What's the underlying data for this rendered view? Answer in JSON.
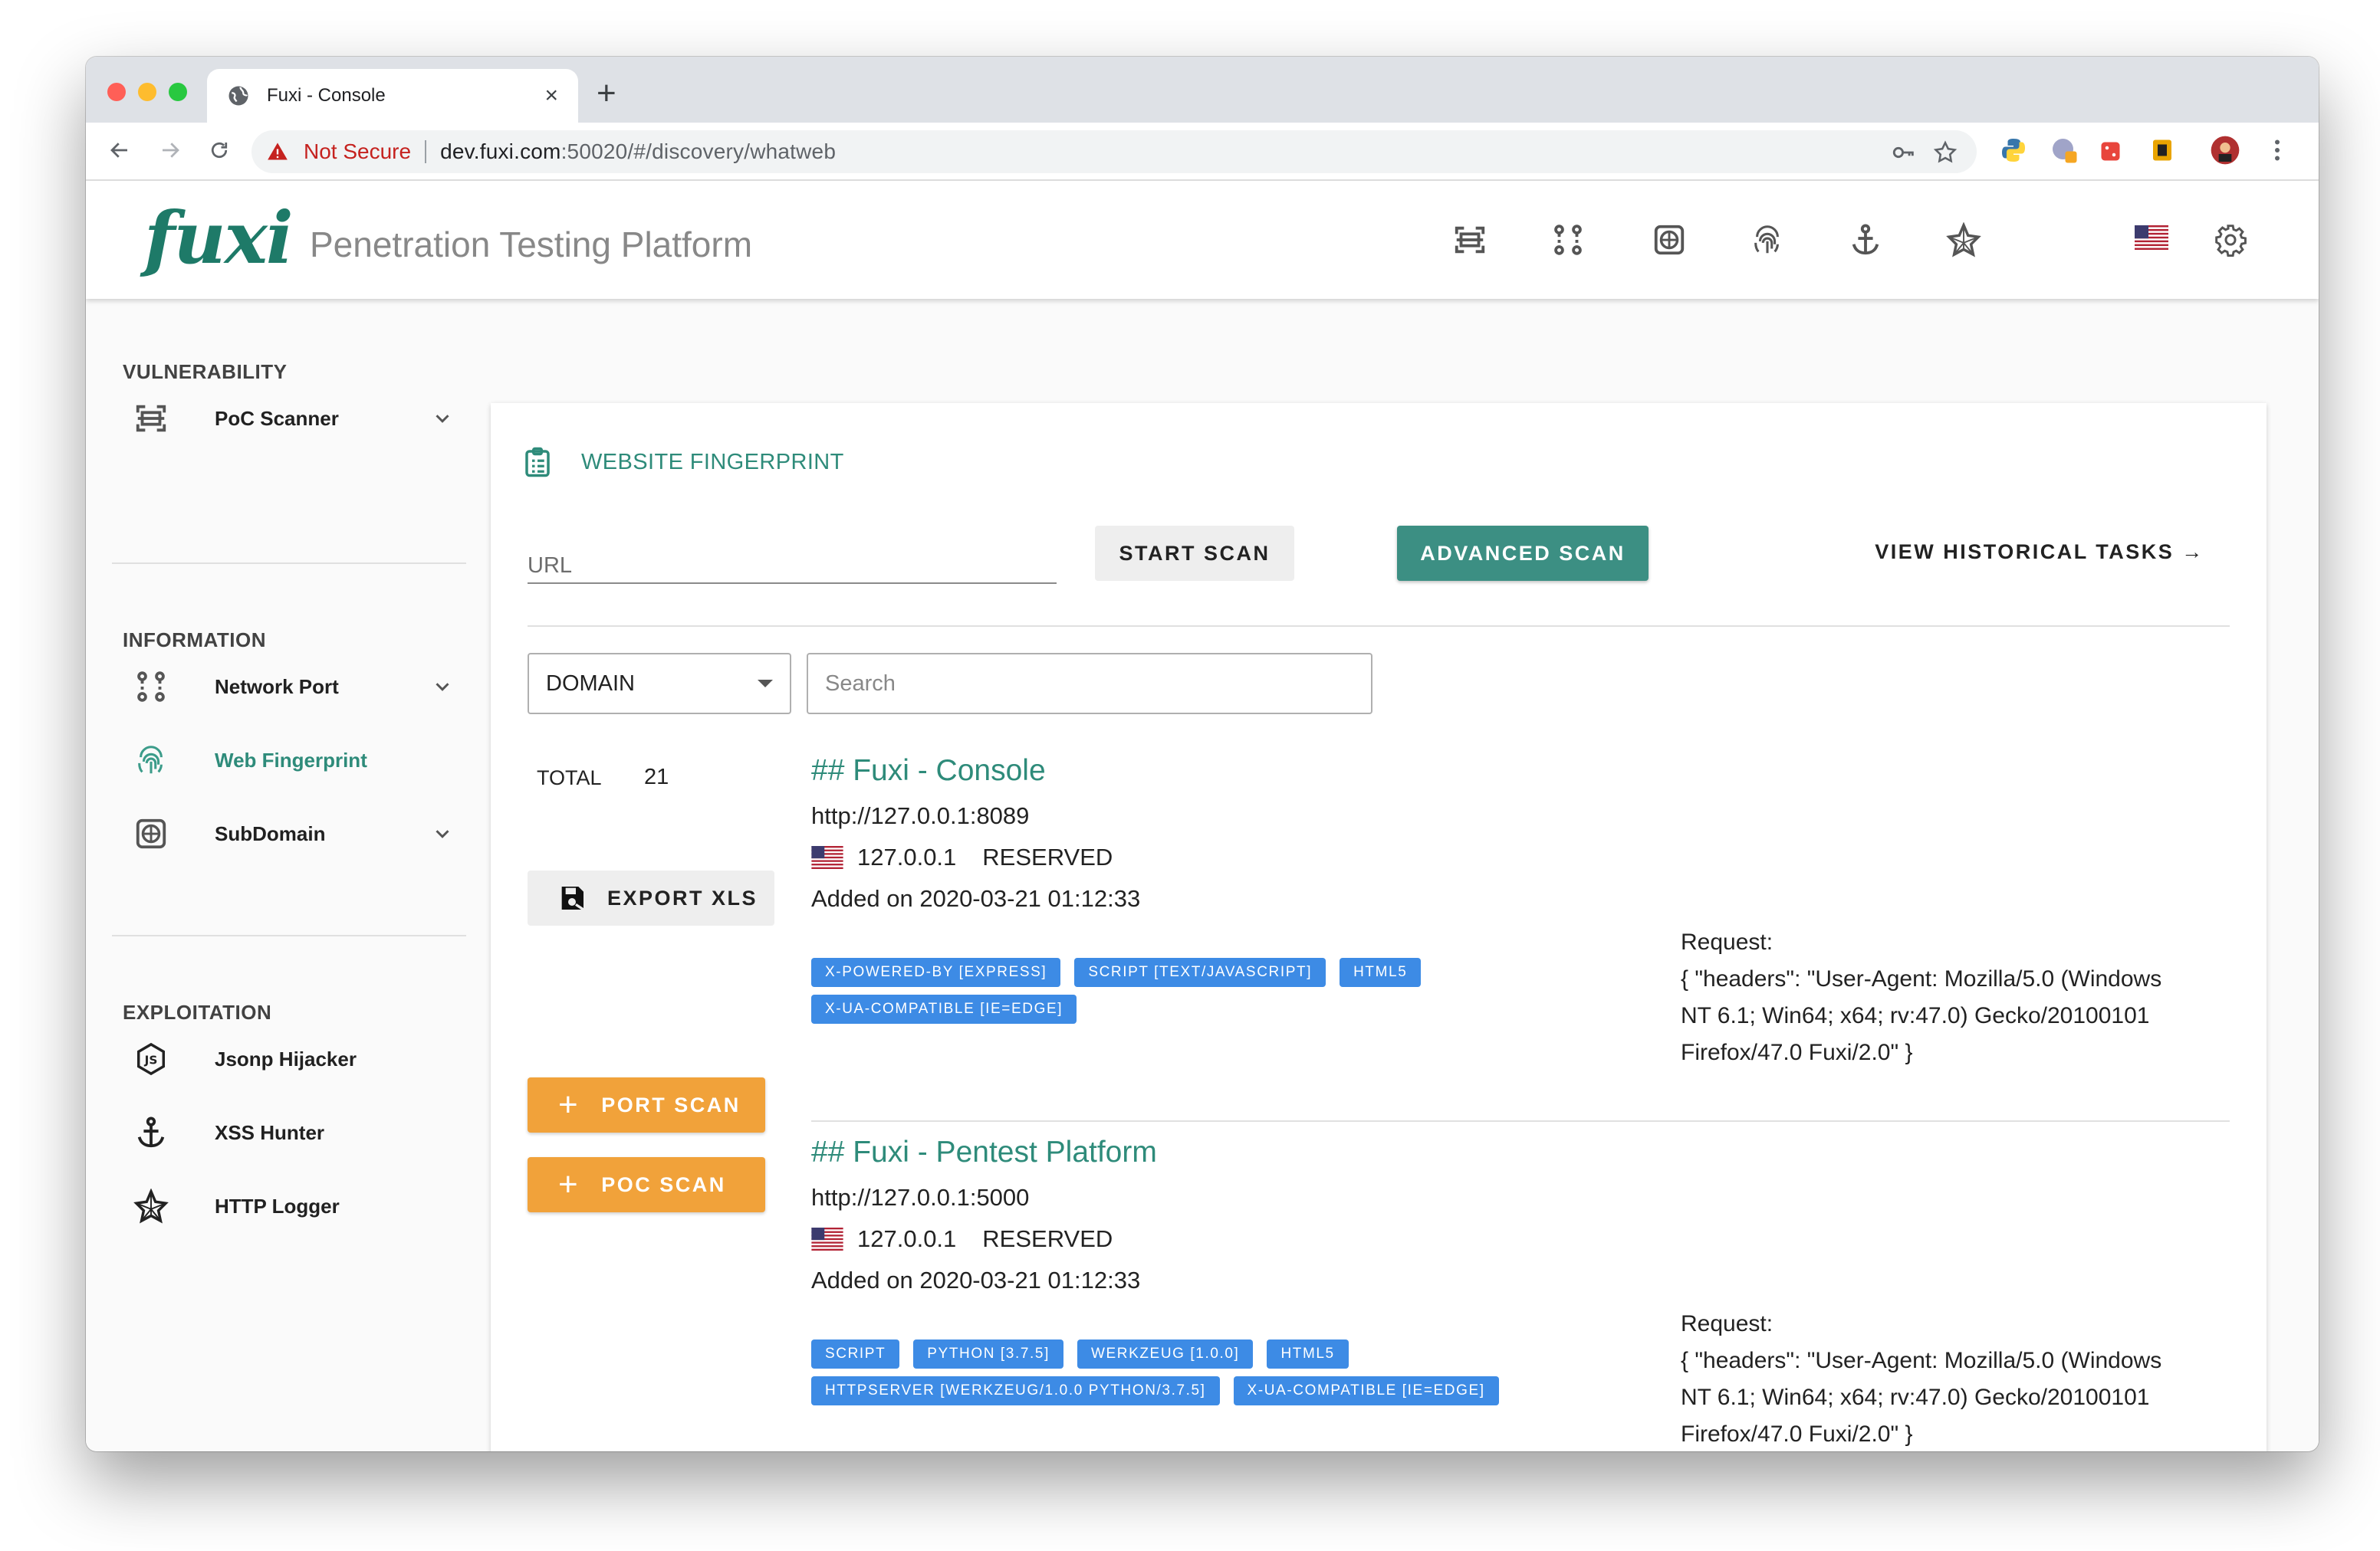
{
  "browser": {
    "tab_title": "Fuxi - Console",
    "new_tab": "+",
    "security_label": "Not Secure",
    "url_host": "dev.fuxi.com",
    "url_path": ":50020/#/discovery/whatweb"
  },
  "header": {
    "logo": "fuxi",
    "title": "Penetration Testing Platform",
    "nav_icons": [
      "scan-icon",
      "network-icon",
      "web-icon",
      "fingerprint-icon",
      "anchor-icon",
      "spider-web-icon"
    ],
    "language_flag": "us-flag",
    "settings_icon": "gear-icon"
  },
  "sidebar": {
    "sections": [
      {
        "title": "VULNERABILITY",
        "items": [
          {
            "label": "PoC Scanner",
            "icon": "scan-icon",
            "expandable": true
          }
        ]
      },
      {
        "title": "INFORMATION",
        "items": [
          {
            "label": "Network Port",
            "icon": "network-icon",
            "expandable": true
          },
          {
            "label": "Web Fingerprint",
            "icon": "fingerprint-icon",
            "expandable": false,
            "active": true
          },
          {
            "label": "SubDomain",
            "icon": "web-icon",
            "expandable": true
          }
        ]
      },
      {
        "title": "EXPLOITATION",
        "items": [
          {
            "label": "Jsonp Hijacker",
            "icon": "js-icon"
          },
          {
            "label": "XSS Hunter",
            "icon": "anchor-icon"
          },
          {
            "label": "HTTP Logger",
            "icon": "spider-web-icon"
          }
        ]
      }
    ]
  },
  "main": {
    "card_title": "WEBSITE FINGERPRINT",
    "url_placeholder": "URL",
    "start_scan": "START SCAN",
    "advanced_scan": "ADVANCED SCAN",
    "view_history": "VIEW HISTORICAL TASKS →",
    "filter_select": "DOMAIN",
    "search_placeholder": "Search",
    "total_label": "TOTAL",
    "total_value": "21",
    "export_xls": "EXPORT XLS",
    "port_scan": "PORT SCAN",
    "poc_scan": "POC SCAN",
    "results": [
      {
        "title": "## Fuxi - Console",
        "url": "http://127.0.0.1:8089",
        "ip": "127.0.0.1",
        "status": "RESERVED",
        "added": "Added on 2020-03-21 01:12:33",
        "chips": [
          "X-POWERED-BY [EXPRESS]",
          "SCRIPT [TEXT/JAVASCRIPT]",
          "HTML5",
          "X-UA-COMPATIBLE [IE=EDGE]"
        ],
        "request_label": "Request:",
        "request_body": "{ \"headers\": \"User-Agent: Mozilla/5.0 (Windows NT 6.1; Win64; x64; rv:47.0) Gecko/20100101 Firefox/47.0 Fuxi/2.0\" }"
      },
      {
        "title": "## Fuxi - Pentest Platform",
        "url": "http://127.0.0.1:5000",
        "ip": "127.0.0.1",
        "status": "RESERVED",
        "added": "Added on 2020-03-21 01:12:33",
        "chips": [
          "SCRIPT",
          "PYTHON [3.7.5]",
          "WERKZEUG [1.0.0]",
          "HTML5",
          "HTTPSERVER [WERKZEUG/1.0.0 PYTHON/3.7.5]",
          "X-UA-COMPATIBLE [IE=EDGE]"
        ],
        "request_label": "Request:",
        "request_body": "{ \"headers\": \"User-Agent: Mozilla/5.0 (Windows NT 6.1; Win64; x64; rv:47.0) Gecko/20100101 Firefox/47.0 Fuxi/2.0\" }"
      }
    ]
  },
  "colors": {
    "accent": "#2e8b7a",
    "teal_button": "#3c8f83",
    "orange_button": "#f1a23a",
    "chip": "#3d8be5",
    "warning": "#c5221f"
  }
}
